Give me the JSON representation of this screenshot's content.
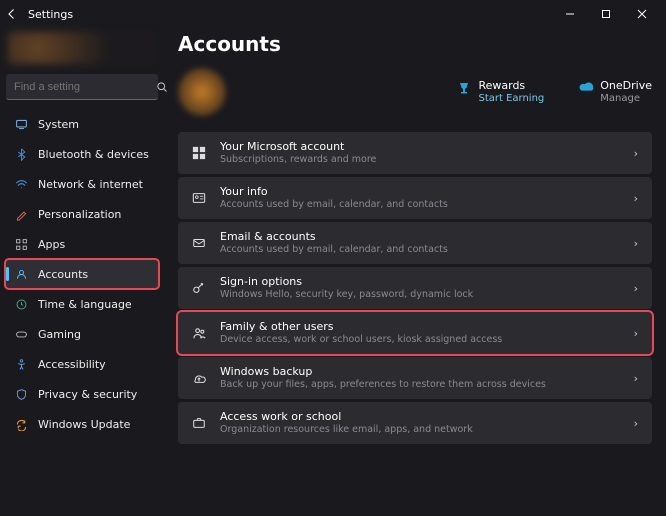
{
  "window": {
    "title": "Settings"
  },
  "search": {
    "placeholder": "Find a setting"
  },
  "sidebar": {
    "items": [
      {
        "label": "System"
      },
      {
        "label": "Bluetooth & devices"
      },
      {
        "label": "Network & internet"
      },
      {
        "label": "Personalization"
      },
      {
        "label": "Apps"
      },
      {
        "label": "Accounts"
      },
      {
        "label": "Time & language"
      },
      {
        "label": "Gaming"
      },
      {
        "label": "Accessibility"
      },
      {
        "label": "Privacy & security"
      },
      {
        "label": "Windows Update"
      }
    ]
  },
  "page": {
    "title": "Accounts",
    "rewards": {
      "title": "Rewards",
      "sub": "Start Earning"
    },
    "onedrive": {
      "title": "OneDrive",
      "sub": "Manage"
    }
  },
  "cards": [
    {
      "title": "Your Microsoft account",
      "desc": "Subscriptions, rewards and more"
    },
    {
      "title": "Your info",
      "desc": "Accounts used by email, calendar, and contacts"
    },
    {
      "title": "Email & accounts",
      "desc": "Accounts used by email, calendar, and contacts"
    },
    {
      "title": "Sign-in options",
      "desc": "Windows Hello, security key, password, dynamic lock"
    },
    {
      "title": "Family & other users",
      "desc": "Device access, work or school users, kiosk assigned access"
    },
    {
      "title": "Windows backup",
      "desc": "Back up your files, apps, preferences to restore them across devices"
    },
    {
      "title": "Access work or school",
      "desc": "Organization resources like email, apps, and network"
    }
  ]
}
